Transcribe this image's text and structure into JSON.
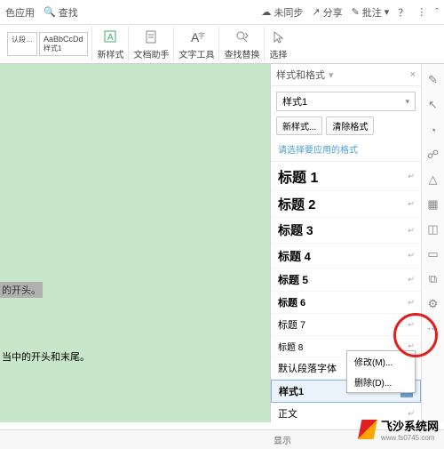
{
  "topbar": {
    "left_app": "色应用",
    "find": "查找",
    "sync": "未同步",
    "share": "分享",
    "comment": "批注"
  },
  "ribbon": {
    "style_sample": "AaBbCcDd",
    "style_row2_a": "认段…",
    "style_row2_b": "样式1",
    "new_style": "新样式",
    "doc_helper": "文档助手",
    "text_tool": "文字工具",
    "find_replace": "查找替换",
    "select": "选择"
  },
  "doc": {
    "line1": "的开头。",
    "line2": "当中的开头和末尾。"
  },
  "panel": {
    "title": "样式和格式",
    "current_style": "样式1",
    "new_btn": "新样式...",
    "clear_btn": "清除格式",
    "hint": "请选择要应用的格式",
    "styles": [
      {
        "name": "标题 1",
        "cls": "h1"
      },
      {
        "name": "标题 2",
        "cls": "h2"
      },
      {
        "name": "标题 3",
        "cls": "h3"
      },
      {
        "name": "标题 4",
        "cls": "h4"
      },
      {
        "name": "标题 5",
        "cls": "h5"
      },
      {
        "name": "标题 6",
        "cls": "h6"
      },
      {
        "name": "标题 7",
        "cls": "h7"
      },
      {
        "name": "标题 8",
        "cls": "h8"
      },
      {
        "name": "默认段落字体",
        "cls": "def",
        "mark": "a"
      },
      {
        "name": "样式1",
        "cls": "sel",
        "dd": true
      },
      {
        "name": "正文",
        "cls": "def"
      }
    ],
    "menu_modify": "修改(M)...",
    "menu_delete": "删除(D)..."
  },
  "status": {
    "show": "显示"
  },
  "watermark": {
    "title": "飞沙系统网",
    "url": "www.fs0745.com"
  }
}
